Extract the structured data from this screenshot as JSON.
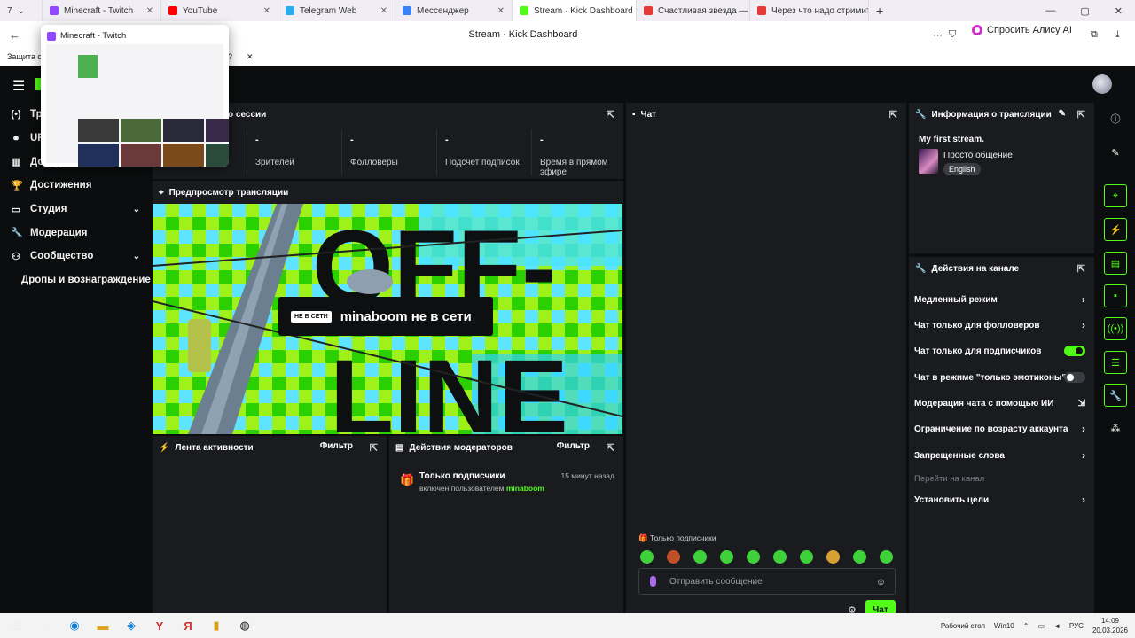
{
  "browser": {
    "tabs": [
      {
        "label": "Minecraft - Twitch",
        "fav_color": "#9146ff",
        "active": false
      },
      {
        "label": "YouTube",
        "fav_color": "#ff0000",
        "active": false
      },
      {
        "label": "Telegram Web",
        "fav_color": "#2aabee",
        "active": false
      },
      {
        "label": "Мессенджер",
        "fav_color": "#3b82f6",
        "active": false
      },
      {
        "label": "Stream · Kick Dashboard",
        "fav_color": "#53fc18",
        "active": true
      },
      {
        "label": "Счастливая звезда — смо",
        "fav_color": "#e53935",
        "active": false
      },
      {
        "label": "Через что надо стримить",
        "fav_color": "#e53935",
        "active": false
      }
    ],
    "tab_counter": "7",
    "page_title": "Stream · Kick Dashboard",
    "alice_label": "Спросить Алису AI",
    "info_prefix": "Защита о",
    "popover_title": "Minecraft - Twitch"
  },
  "sidebar": {
    "items": [
      {
        "icon": "broadcast-icon",
        "glyph": "(•)",
        "label": "Трансляция",
        "chev": false,
        "sub": false
      },
      {
        "icon": "link-icon",
        "glyph": "⚭",
        "label": "URL",
        "chev": false,
        "sub": false
      },
      {
        "icon": "income-icon",
        "glyph": "▥",
        "label": "Доход",
        "chev": false,
        "sub": false
      },
      {
        "icon": "trophy-icon",
        "glyph": "🏆",
        "label": "Достижения",
        "chev": false,
        "sub": false
      },
      {
        "icon": "studio-icon",
        "glyph": "▭",
        "label": "Студия",
        "chev": true,
        "sub": false
      },
      {
        "icon": "wrench-icon",
        "glyph": "🔧",
        "label": "Модерация",
        "chev": false,
        "sub": false
      },
      {
        "icon": "community-icon",
        "glyph": "⚇",
        "label": "Сообщество",
        "chev": true,
        "sub": false
      },
      {
        "icon": "",
        "glyph": "",
        "label": "Дропы и вознаграждение",
        "chev": false,
        "sub": true
      }
    ]
  },
  "session": {
    "title": "о сессии",
    "stats": [
      {
        "value": "",
        "label": "Сессия"
      },
      {
        "value": "-",
        "label": "Зрителей"
      },
      {
        "value": "-",
        "label": "Фолловеры"
      },
      {
        "value": "-",
        "label": "Подсчет подписок"
      },
      {
        "value": "-",
        "label": "Время в прямом эфире"
      }
    ]
  },
  "preview": {
    "title": "Предпросмотр трансляции",
    "art_text_top": "OFF-",
    "art_text_bottom": "LINE",
    "badge": "НЕ В СЕТИ",
    "message": "minaboom не в сети"
  },
  "activity": {
    "title": "Лента активности",
    "filter": "Фильтр"
  },
  "mod_actions": {
    "title": "Действия модераторов",
    "filter": "Фильтр",
    "entry_title": "Только подписчики",
    "entry_sub": "включен пользователем",
    "entry_user": "minaboom",
    "entry_time": "15 минут назад"
  },
  "chat": {
    "title": "Чат",
    "mode": "Только подписчики",
    "placeholder": "Отправить сообщение",
    "send": "Чат",
    "emote_count": 10
  },
  "stream_info": {
    "title": "Информация о трансляции",
    "stream_title": "My first stream.",
    "category": "Просто общение",
    "language": "English"
  },
  "channel_actions": {
    "title": "Действия на канале",
    "items": [
      {
        "label": "Медленный режим",
        "kind": "arrow"
      },
      {
        "label": "Чат только для фолловеров",
        "kind": "arrow"
      },
      {
        "label": "Чат только для подписчиков",
        "kind": "toggle",
        "on": true
      },
      {
        "label": "Чат в режиме \"только эмотиконы\"",
        "kind": "toggle",
        "on": false
      },
      {
        "label": "Модерация чата с помощью ИИ",
        "kind": "ext"
      },
      {
        "label": "Ограничение по возрасту аккаунта",
        "kind": "arrow"
      },
      {
        "label": "Запрещенные слова",
        "kind": "arrow"
      },
      {
        "label": "Перейти на канал",
        "kind": "muted"
      },
      {
        "label": "Установить цели",
        "kind": "arrow"
      }
    ]
  },
  "taskbar": {
    "desktop": "Рабочий стол",
    "weather": "Win10",
    "lang": "РУС",
    "time": "14:09",
    "date": "20.03.2026"
  },
  "colors": {
    "accent": "#53fc18",
    "panel": "#191b1f",
    "bg": "#0b0d0e"
  }
}
